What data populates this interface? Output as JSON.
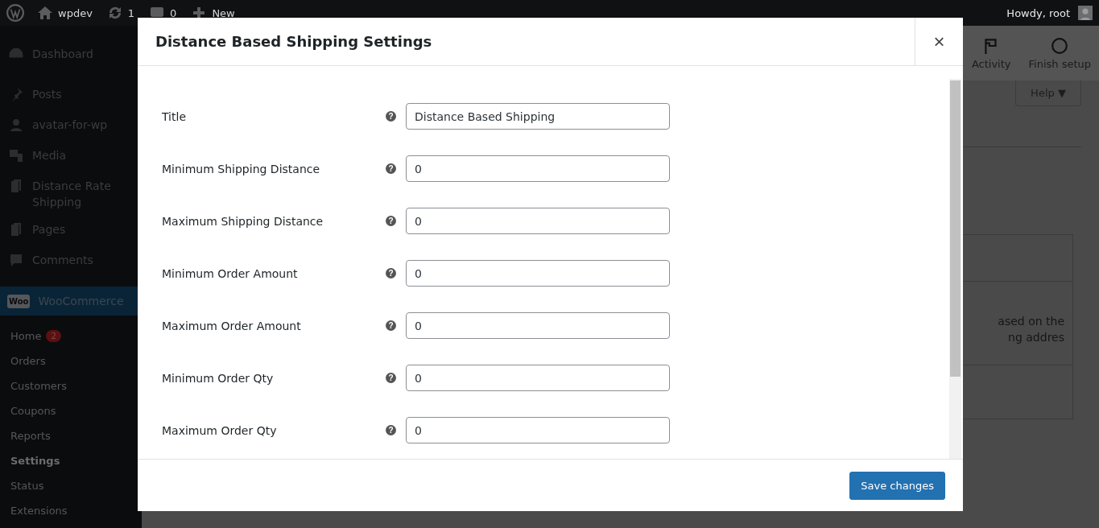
{
  "admin_bar": {
    "site": "wpdev",
    "updates": "1",
    "comments": "0",
    "new": "New",
    "greeting": "Howdy, root"
  },
  "sidebar": {
    "items": [
      {
        "label": "Dashboard",
        "kind": "gauge"
      },
      {
        "label": "Posts",
        "kind": "pin"
      },
      {
        "label": "avatar-for-wp",
        "kind": "user"
      },
      {
        "label": "Media",
        "kind": "media"
      },
      {
        "label": "Distance Rate Shipping",
        "kind": "pages"
      },
      {
        "label": "Pages",
        "kind": "pages"
      },
      {
        "label": "Comments",
        "kind": "comment"
      }
    ],
    "woocommerce": {
      "label": "WooCommerce",
      "logo": "Woo"
    },
    "submenu": [
      {
        "label": "Home",
        "badge": "2",
        "selected": false
      },
      {
        "label": "Orders",
        "selected": false
      },
      {
        "label": "Customers",
        "selected": false
      },
      {
        "label": "Coupons",
        "selected": false
      },
      {
        "label": "Reports",
        "selected": false
      },
      {
        "label": "Settings",
        "selected": true
      },
      {
        "label": "Status",
        "selected": false
      },
      {
        "label": "Extensions",
        "selected": false
      }
    ]
  },
  "header_actions": [
    "Activity",
    "Finish setup"
  ],
  "help": "Help ▼",
  "background_text": [
    "ased on the",
    "ng addres"
  ],
  "modal": {
    "title": "Distance Based Shipping Settings",
    "close": "×",
    "fields": [
      {
        "label": "Title",
        "help": "?",
        "value": "Distance Based Shipping"
      },
      {
        "label": "Minimum Shipping Distance",
        "help": "?",
        "value": "0"
      },
      {
        "label": "Maximum Shipping Distance",
        "help": "?",
        "value": "0"
      },
      {
        "label": "Minimum Order Amount",
        "help": "?",
        "value": "0"
      },
      {
        "label": "Maximum Order Amount",
        "help": "?",
        "value": "0"
      },
      {
        "label": "Minimum Order Qty",
        "help": "?",
        "value": "0"
      },
      {
        "label": "Maximum Order Qty",
        "help": "?",
        "value": "0"
      }
    ],
    "save": "Save changes"
  }
}
